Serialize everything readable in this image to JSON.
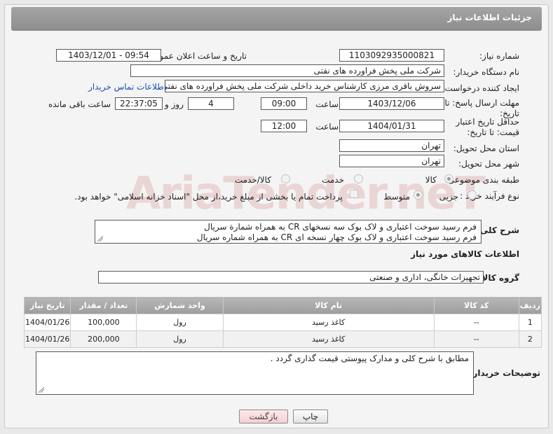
{
  "header": {
    "title": "جزئیات اطلاعات نیاز"
  },
  "fields": {
    "need_number_label": "شماره نیاز:",
    "need_number": "1103092935000821",
    "announce_label": "تاریخ و ساعت اعلان عمومی:",
    "announce_value": "1403/12/01 - 09:54",
    "buyer_org_label": "نام دستگاه خریدار:",
    "buyer_org": "شرکت ملی پخش فراورده های نفتی",
    "requester_label": "ایجاد کننده درخواست:",
    "requester": "سروش باقری مرزی کارشناس خرید داخلی شرکت ملی پخش فراورده های نفتی",
    "contact_link": "اطلاعات تماس خریدار",
    "deadline_label": "مهلت ارسال پاسخ: تا تاریخ:",
    "deadline_date": "1403/12/06",
    "time_label": "ساعت",
    "deadline_time": "09:00",
    "days_value": "4",
    "days_label": "روز و",
    "remaining_time": "22:37:05",
    "remaining_label": "ساعت باقی مانده",
    "validity_label": "حداقل تاریخ اعتبار قیمت: تا تاریخ:",
    "validity_date": "1404/01/31",
    "validity_time_label": "ساعت",
    "validity_time": "12:00",
    "province_label": "استان محل تحویل:",
    "province": "تهران",
    "city_label": "شهر محل تحویل:",
    "city": "تهران",
    "category_label": "طبقه بندی موضوعی:",
    "category_options": [
      "کالا",
      "خدمت",
      "کالا/خدمت"
    ],
    "purchase_type_label": "نوع فرآیند خرید :",
    "purchase_type_options": [
      "جزیی",
      "متوسط"
    ],
    "payment_note": "پرداخت تمام یا بخشی از مبلغ خرید،از محل \"اسناد خزانه اسلامی\" خواهد بود."
  },
  "description": {
    "label": "شرح کلی نیاز:",
    "line1": "فرم رسید سوخت اعتباری و لاک بوک سه نسخهای CR  به همراه شمارة سریال",
    "line2": "فرم رسید سوخت اعتباری و لاک بوک چهار نسخه ای  CR به همراه شماره سریال"
  },
  "goods": {
    "section_title": "اطلاعات کالاهای مورد نیاز",
    "group_label": "گروه کالا:",
    "group_value": "تجهیزات خانگی، اداری و صنعتی",
    "columns": [
      "ردیف",
      "کد کالا",
      "نام کالا",
      "واحد شمارش",
      "تعداد / مقدار",
      "تاریخ نیاز"
    ],
    "rows": [
      [
        "1",
        "--",
        "کاغذ رسید",
        "رول",
        "100,000",
        "1404/01/26"
      ],
      [
        "2",
        "--",
        "کاغذ رسید",
        "رول",
        "200,000",
        "1404/01/26"
      ]
    ]
  },
  "buyer_notes": {
    "label": "توضیحات خریدار:",
    "text": "مطابق با شرح کلی و مدارک پیوستی قیمت گذاری گردد ."
  },
  "buttons": {
    "print": "چاپ",
    "back": "بازگشت"
  },
  "watermark": "AriaTender.neT"
}
